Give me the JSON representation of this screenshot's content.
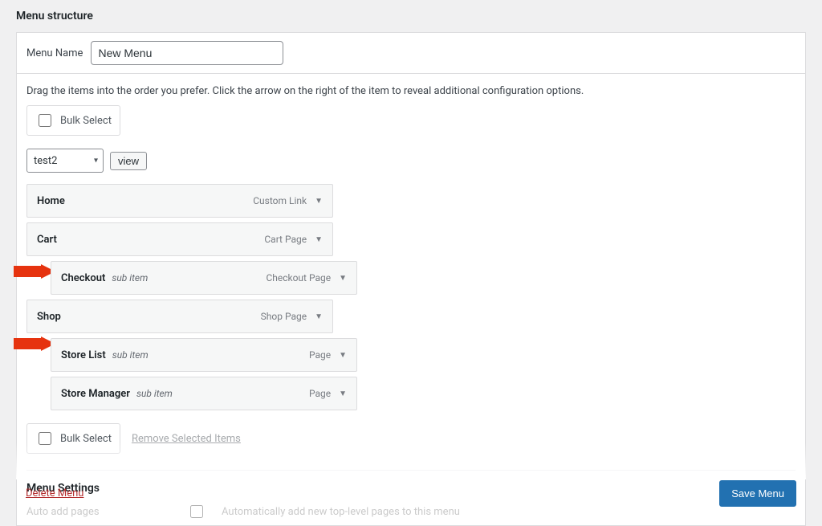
{
  "panel": {
    "title": "Menu structure",
    "menu_name_label": "Menu Name",
    "menu_name_value": "New Menu",
    "instructions": "Drag the items into the order you prefer. Click the arrow on the right of the item to reveal additional configuration options.",
    "bulk_select": "Bulk Select",
    "select_value": "test2",
    "view_btn": "view",
    "remove_selected": "Remove Selected Items",
    "settings_title": "Menu Settings",
    "auto_add_label": "Auto add pages",
    "auto_add_desc": "Automatically add new top-level pages to this menu",
    "delete": "Delete Menu",
    "save": "Save Menu"
  },
  "items": [
    {
      "title": "Home",
      "sub": "",
      "type": "Custom Link",
      "indent": false
    },
    {
      "title": "Cart",
      "sub": "",
      "type": "Cart Page",
      "indent": false
    },
    {
      "title": "Checkout",
      "sub": "sub item",
      "type": "Checkout Page",
      "indent": true
    },
    {
      "title": "Shop",
      "sub": "",
      "type": "Shop Page",
      "indent": false
    },
    {
      "title": "Store List",
      "sub": "sub item",
      "type": "Page",
      "indent": true
    },
    {
      "title": "Store Manager",
      "sub": "sub item",
      "type": "Page",
      "indent": true
    }
  ]
}
